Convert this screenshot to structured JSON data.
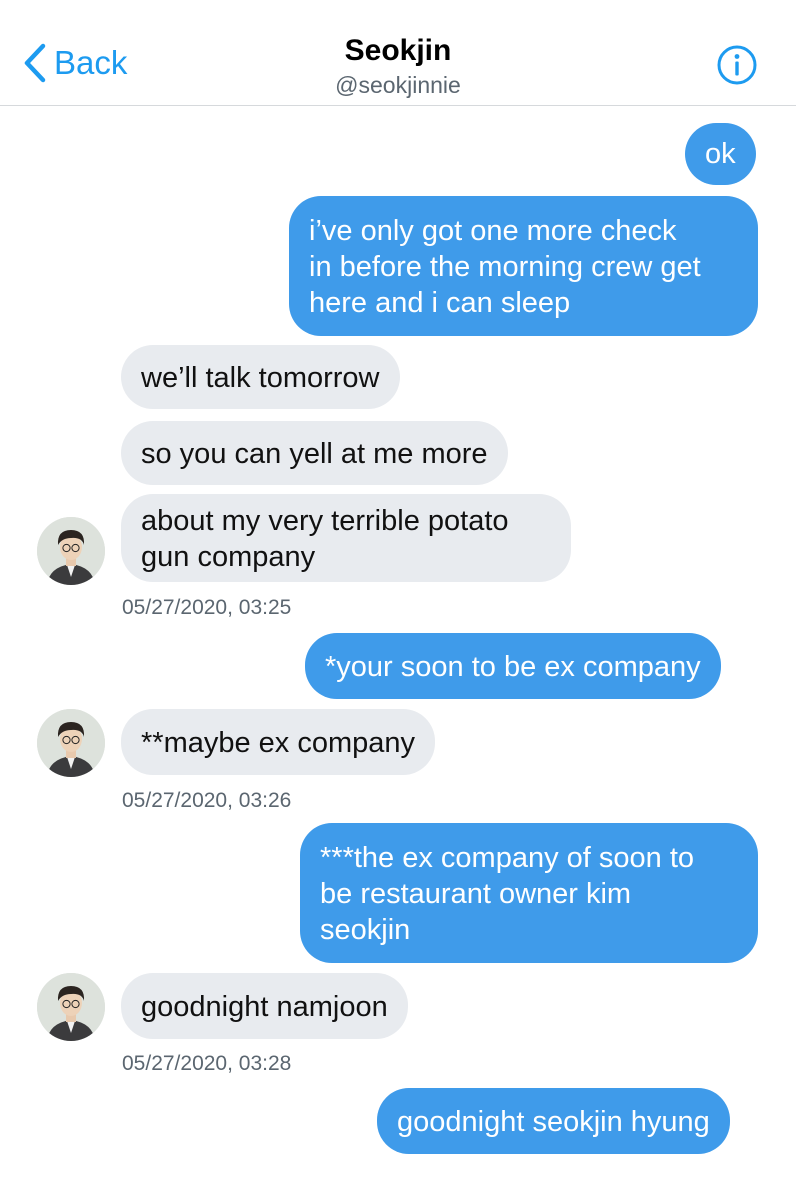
{
  "header": {
    "back_label": "Back",
    "name": "Seokjin",
    "handle": "@seokjinnie"
  },
  "colors": {
    "accent": "#1d9bf0",
    "outgoing_bubble": "#3f9bea",
    "incoming_bubble": "#e8ebef",
    "timestamp_text": "#5b6670"
  },
  "icons": {
    "back": "chevron-left-icon",
    "info": "info-circle-icon"
  },
  "messages": [
    {
      "direction": "outgoing",
      "lines": [
        "ok"
      ]
    },
    {
      "direction": "outgoing",
      "lines": [
        "i’ve only got one more check",
        "in before the morning crew get",
        "here and i can sleep"
      ]
    },
    {
      "direction": "incoming",
      "lines": [
        "we’ll talk tomorrow"
      ]
    },
    {
      "direction": "incoming",
      "lines": [
        "so you can yell at me more"
      ]
    },
    {
      "direction": "incoming",
      "lines": [
        "about my very terrible potato",
        "gun company"
      ]
    },
    {
      "direction": "outgoing",
      "lines": [
        "*your soon to be ex company"
      ]
    },
    {
      "direction": "incoming",
      "lines": [
        "**maybe ex company"
      ]
    },
    {
      "direction": "outgoing",
      "lines": [
        "***the ex company of soon to",
        "be restaurant owner kim",
        "seokjin"
      ]
    },
    {
      "direction": "incoming",
      "lines": [
        "goodnight namjoon"
      ]
    },
    {
      "direction": "outgoing",
      "lines": [
        "goodnight seokjin hyung"
      ]
    }
  ],
  "timestamps": [
    "05/27/2020, 03:25",
    "05/27/2020, 03:26",
    "05/27/2020, 03:28"
  ]
}
